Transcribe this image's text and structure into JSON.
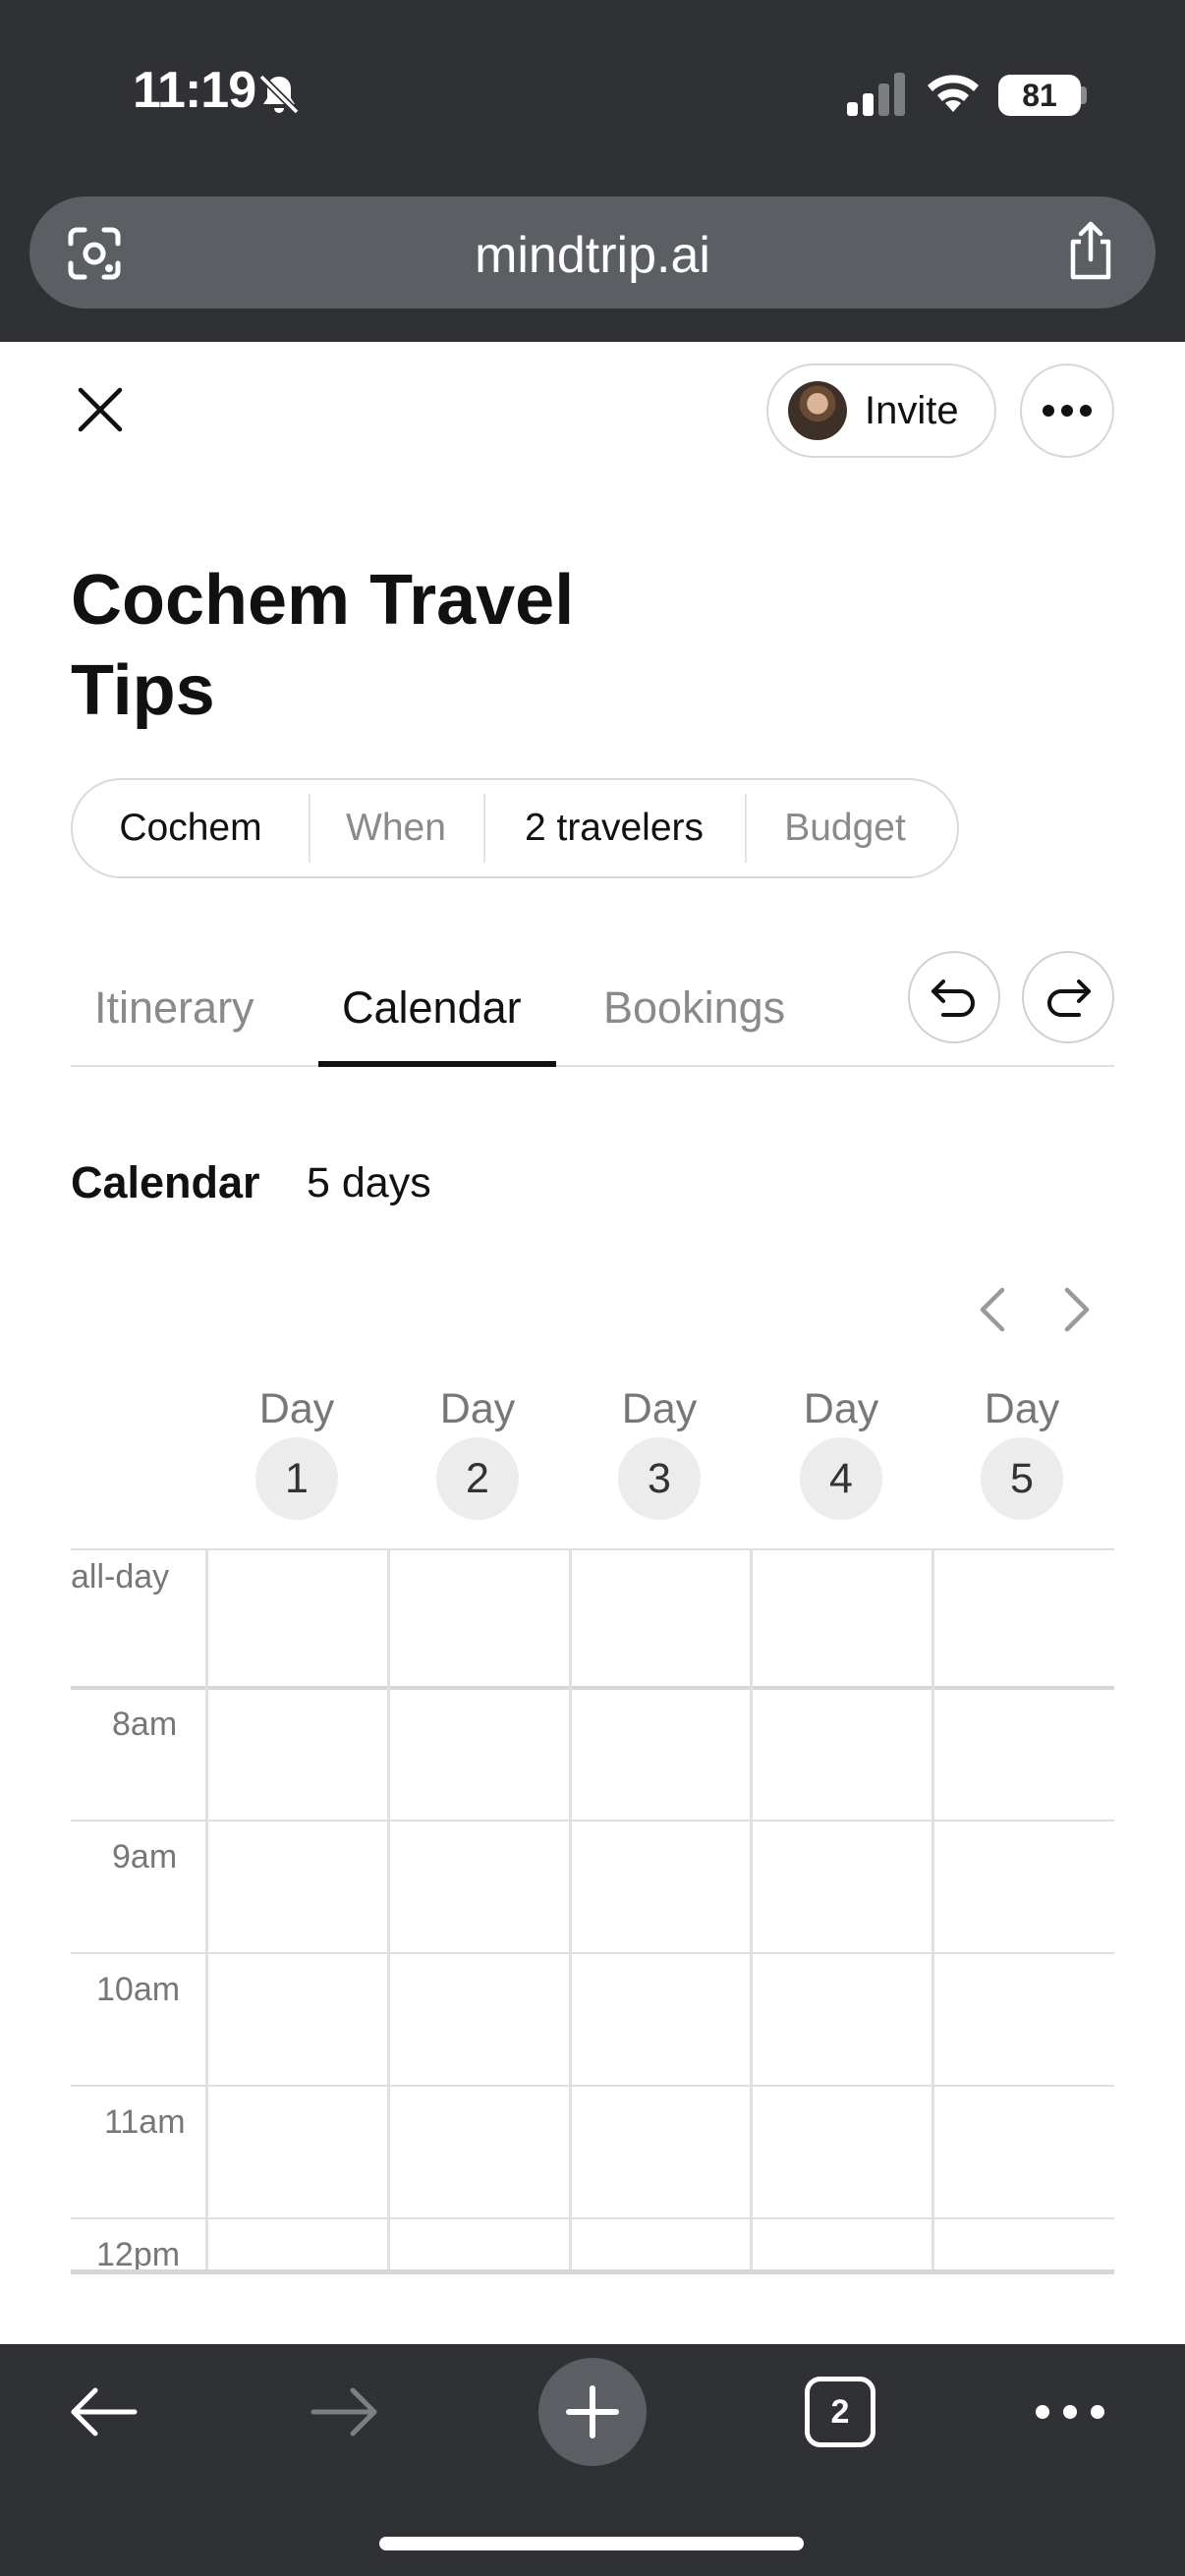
{
  "status_bar": {
    "time": "11:19",
    "battery": "81"
  },
  "browser": {
    "url": "mindtrip.ai",
    "tab_count": "2"
  },
  "header": {
    "invite_label": "Invite"
  },
  "trip": {
    "title": "Cochem Travel Tips",
    "chips": [
      {
        "label": "Cochem"
      },
      {
        "label": "When"
      },
      {
        "label": "2 travelers"
      },
      {
        "label": "Budget"
      }
    ]
  },
  "tabs": [
    {
      "label": "Itinerary"
    },
    {
      "label": "Calendar"
    },
    {
      "label": "Bookings"
    }
  ],
  "calendar": {
    "title": "Calendar",
    "duration": "5 days",
    "day_word": "Day",
    "days": [
      {
        "number": "1"
      },
      {
        "number": "2"
      },
      {
        "number": "3"
      },
      {
        "number": "4"
      },
      {
        "number": "5"
      }
    ],
    "rows": [
      {
        "label": "all-day"
      },
      {
        "label": "8am"
      },
      {
        "label": "9am"
      },
      {
        "label": "10am"
      },
      {
        "label": "11am"
      },
      {
        "label": "12pm"
      }
    ]
  },
  "colors": {
    "browser_chrome": "#2f3135",
    "url_bar": "#5b5e62",
    "active_tab_underline": "#111111"
  }
}
